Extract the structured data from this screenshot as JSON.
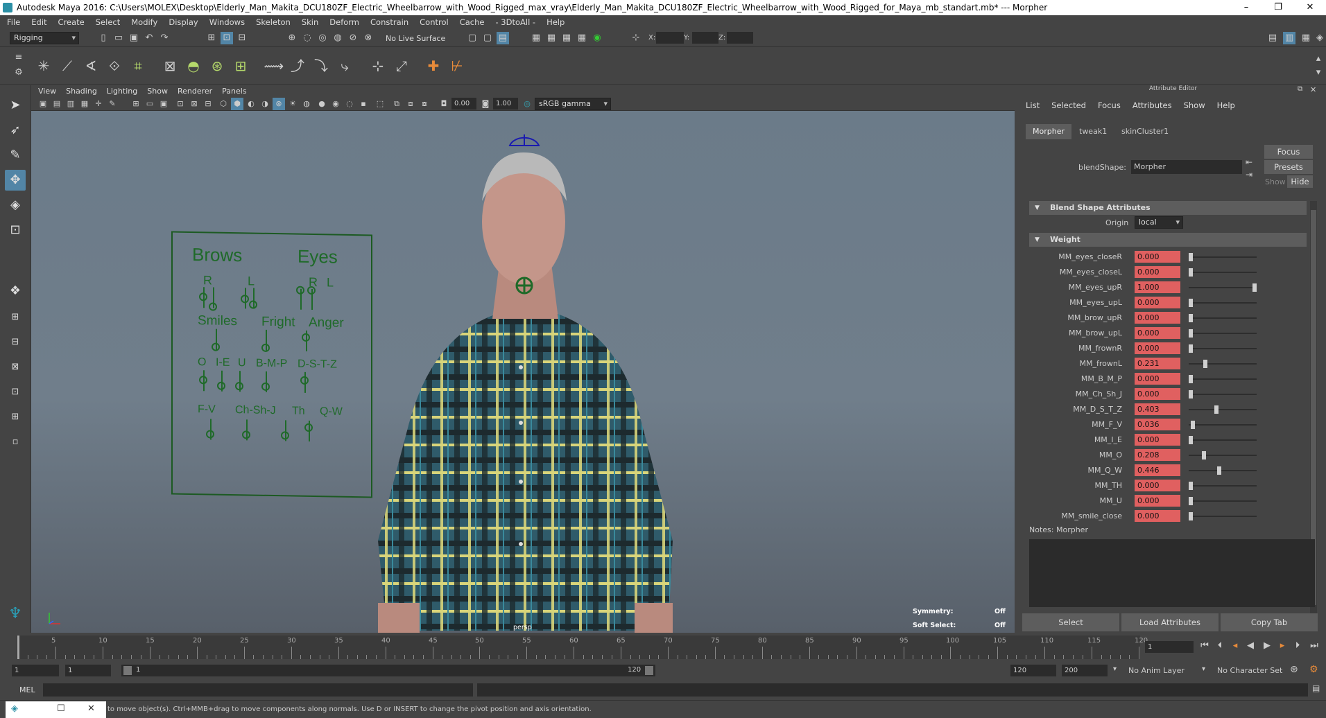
{
  "window": {
    "title": "Autodesk Maya 2016: C:\\Users\\MOLEX\\Desktop\\Elderly_Man_Makita_DCU180ZF_Electric_Wheelbarrow_with_Wood_Rigged_max_vray\\Elderly_Man_Makita_DCU180ZF_Electric_Wheelbarrow_with_Wood_Rigged_for_Maya_mb_standart.mb*  ---  Morpher",
    "controls": [
      "–",
      "❐",
      "✕"
    ]
  },
  "menubar": [
    "File",
    "Edit",
    "Create",
    "Select",
    "Modify",
    "Display",
    "Windows",
    "Skeleton",
    "Skin",
    "Deform",
    "Constrain",
    "Control",
    "Cache",
    "- 3DtoAll -",
    "Help"
  ],
  "statusline": {
    "menuset": "Rigging",
    "live_surface": "No Live Surface",
    "x_label": "X:",
    "y_label": "Y:",
    "z_label": "Z:"
  },
  "viewport": {
    "menu": [
      "View",
      "Shading",
      "Lighting",
      "Show",
      "Renderer",
      "Panels"
    ],
    "near_value": "0.00",
    "far_value": "1.00",
    "color_space": "sRGB gamma",
    "camera_label": "persp",
    "hud": {
      "symmetry_label": "Symmetry:",
      "symmetry_value": "Off",
      "soft_select_label": "Soft Select:",
      "soft_select_value": "Off"
    },
    "picker": {
      "brows": "Brows",
      "eyes": "Eyes",
      "brows_r": "R",
      "brows_l": "L",
      "eyes_r": "R",
      "eyes_l": "L",
      "smiles": "Smiles",
      "fright": "Fright",
      "anger": "Anger",
      "o": "O",
      "ie": "I-E",
      "u": "U",
      "bmp": "B-M-P",
      "dstz": "D-S-T-Z",
      "fv": "F-V",
      "chshj": "Ch-Sh-J",
      "th": "Th",
      "qw": "Q-W"
    }
  },
  "attribute_editor": {
    "header": "Attribute Editor",
    "menu": [
      "List",
      "Selected",
      "Focus",
      "Attributes",
      "Show",
      "Help"
    ],
    "tabs": [
      "Morpher",
      "tweak1",
      "skinCluster1"
    ],
    "node_label": "blendShape:",
    "node_value": "Morpher",
    "side_buttons": {
      "focus": "Focus",
      "presets": "Presets",
      "show": "Show",
      "hide": "Hide"
    },
    "blend_section": "Blend Shape Attributes",
    "origin_label": "Origin",
    "origin_value": "local",
    "weight_section": "Weight",
    "weights": [
      {
        "name": "MM_eyes_closeR",
        "value": "0.000",
        "frac": 0.0
      },
      {
        "name": "MM_eyes_closeL",
        "value": "0.000",
        "frac": 0.0
      },
      {
        "name": "MM_eyes_upR",
        "value": "1.000",
        "frac": 1.0
      },
      {
        "name": "MM_eyes_upL",
        "value": "0.000",
        "frac": 0.0
      },
      {
        "name": "MM_brow_upR",
        "value": "0.000",
        "frac": 0.0
      },
      {
        "name": "MM_brow_upL",
        "value": "0.000",
        "frac": 0.0
      },
      {
        "name": "MM_frownR",
        "value": "0.000",
        "frac": 0.0
      },
      {
        "name": "MM_frownL",
        "value": "0.231",
        "frac": 0.231
      },
      {
        "name": "MM_B_M_P",
        "value": "0.000",
        "frac": 0.0
      },
      {
        "name": "MM_Ch_Sh_J",
        "value": "0.000",
        "frac": 0.0
      },
      {
        "name": "MM_D_S_T_Z",
        "value": "0.403",
        "frac": 0.403
      },
      {
        "name": "MM_F_V",
        "value": "0.036",
        "frac": 0.036
      },
      {
        "name": "MM_I_E",
        "value": "0.000",
        "frac": 0.0
      },
      {
        "name": "MM_O",
        "value": "0.208",
        "frac": 0.208
      },
      {
        "name": "MM_Q_W",
        "value": "0.446",
        "frac": 0.446
      },
      {
        "name": "MM_TH",
        "value": "0.000",
        "frac": 0.0
      },
      {
        "name": "MM_U",
        "value": "0.000",
        "frac": 0.0
      },
      {
        "name": "MM_smile_close",
        "value": "0.000",
        "frac": 0.0
      }
    ],
    "notes_label": "Notes: Morpher",
    "buttons": {
      "select": "Select",
      "load": "Load Attributes",
      "copy": "Copy Tab"
    }
  },
  "timeline": {
    "ticks": [
      "5",
      "10",
      "15",
      "20",
      "25",
      "30",
      "35",
      "40",
      "45",
      "50",
      "55",
      "60",
      "65",
      "70",
      "75",
      "80",
      "85",
      "90",
      "95",
      "100",
      "105",
      "110",
      "115",
      "120"
    ],
    "start_mark": "1",
    "current_frame": "1"
  },
  "range": {
    "start": "1",
    "inner_start": "1",
    "slider_start": "1",
    "slider_end": "120",
    "end": "120",
    "outer_end": "200",
    "anim_layer": "No Anim Layer",
    "character_set": "No Character Set"
  },
  "command_line": {
    "label": "MEL"
  },
  "help_line": {
    "text": "to move object(s). Ctrl+MMB+drag to move components along normals. Use D or INSERT to change the pivot position and axis orientation."
  },
  "colors": {
    "weight_field": "#e06060",
    "active_tool": "#5285a6",
    "picker": "#1f6a29"
  }
}
